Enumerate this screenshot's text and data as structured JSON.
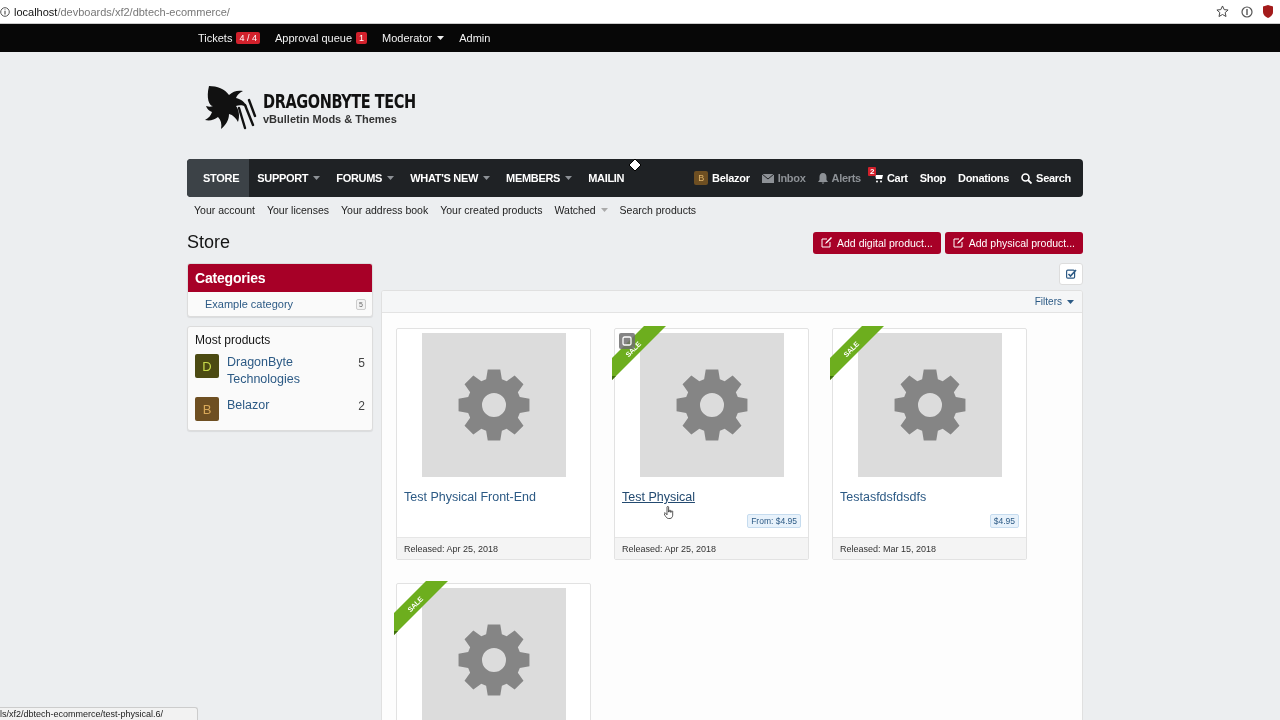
{
  "browser": {
    "url_host": "localhost",
    "url_path": "/devboards/xf2/dbtech-ecommerce/"
  },
  "staff_bar": [
    {
      "label": "Tickets",
      "badge": "4 / 4",
      "dropdown": false
    },
    {
      "label": "Approval queue",
      "badge": "1",
      "dropdown": false
    },
    {
      "label": "Moderator",
      "dropdown": true
    },
    {
      "label": "Admin",
      "dropdown": false
    }
  ],
  "logo": {
    "title": "DRAGONBYTE TECH",
    "tagline": "vBulletin Mods & Themes"
  },
  "nav": {
    "tabs": [
      {
        "label": "STORE",
        "selected": true,
        "dropdown": false
      },
      {
        "label": "SUPPORT",
        "selected": false,
        "dropdown": true
      },
      {
        "label": "FORUMS",
        "selected": false,
        "dropdown": true
      },
      {
        "label": "WHAT'S NEW",
        "selected": false,
        "dropdown": true
      },
      {
        "label": "MEMBERS",
        "selected": false,
        "dropdown": true
      },
      {
        "label": "MAILIN",
        "selected": false,
        "dropdown": false
      }
    ],
    "user_links": [
      {
        "kind": "user",
        "label": "Belazor",
        "avatar": "B",
        "color": "#6e4f22",
        "dimmed": false
      },
      {
        "kind": "inbox",
        "label": "Inbox",
        "dimmed": true
      },
      {
        "kind": "alerts",
        "label": "Alerts",
        "dimmed": true
      },
      {
        "kind": "cart",
        "label": "Cart",
        "badge": "2",
        "dimmed": false
      },
      {
        "kind": "link",
        "label": "Shop",
        "dimmed": false
      },
      {
        "kind": "link",
        "label": "Donations",
        "dimmed": false
      },
      {
        "kind": "search",
        "label": "Search",
        "dimmed": false
      }
    ]
  },
  "sub_nav": [
    {
      "label": "Your account",
      "dropdown": false
    },
    {
      "label": "Your licenses",
      "dropdown": false
    },
    {
      "label": "Your address book",
      "dropdown": false
    },
    {
      "label": "Your created products",
      "dropdown": false
    },
    {
      "label": "Watched",
      "dropdown": true
    },
    {
      "label": "Search products",
      "dropdown": false
    }
  ],
  "page_title": "Store",
  "actions": [
    {
      "label": "Add digital product..."
    },
    {
      "label": "Add physical product..."
    }
  ],
  "sidebar": {
    "categories": {
      "title": "Categories",
      "items": [
        {
          "label": "Example category",
          "count": "5"
        }
      ]
    },
    "most_products": {
      "title": "Most products",
      "items": [
        {
          "name": "DragonByte Technologies",
          "avatar": "D",
          "color": "#4b4a12",
          "count": "5"
        },
        {
          "name": "Belazor",
          "avatar": "B",
          "color": "#6e4f22",
          "count": "2"
        }
      ]
    }
  },
  "filters": {
    "label": "Filters"
  },
  "products": [
    {
      "title": "Test Physical Front-End",
      "released": "Released: Apr 25, 2018",
      "hovered": false
    },
    {
      "title": "Test Physical",
      "price": "From: $4.95",
      "released": "Released: Apr 25, 2018",
      "ribbon": "SALE",
      "hovered": true
    },
    {
      "title": "Testasfdsfdsdfs",
      "price": "$4.95",
      "released": "Released: Mar 15, 2018",
      "ribbon": "SALE",
      "hovered": false
    },
    {
      "ribbon": "SALE",
      "hovered": false
    }
  ],
  "status_url": "ls/xf2/dbtech-ecommerce/test-physical.6/"
}
